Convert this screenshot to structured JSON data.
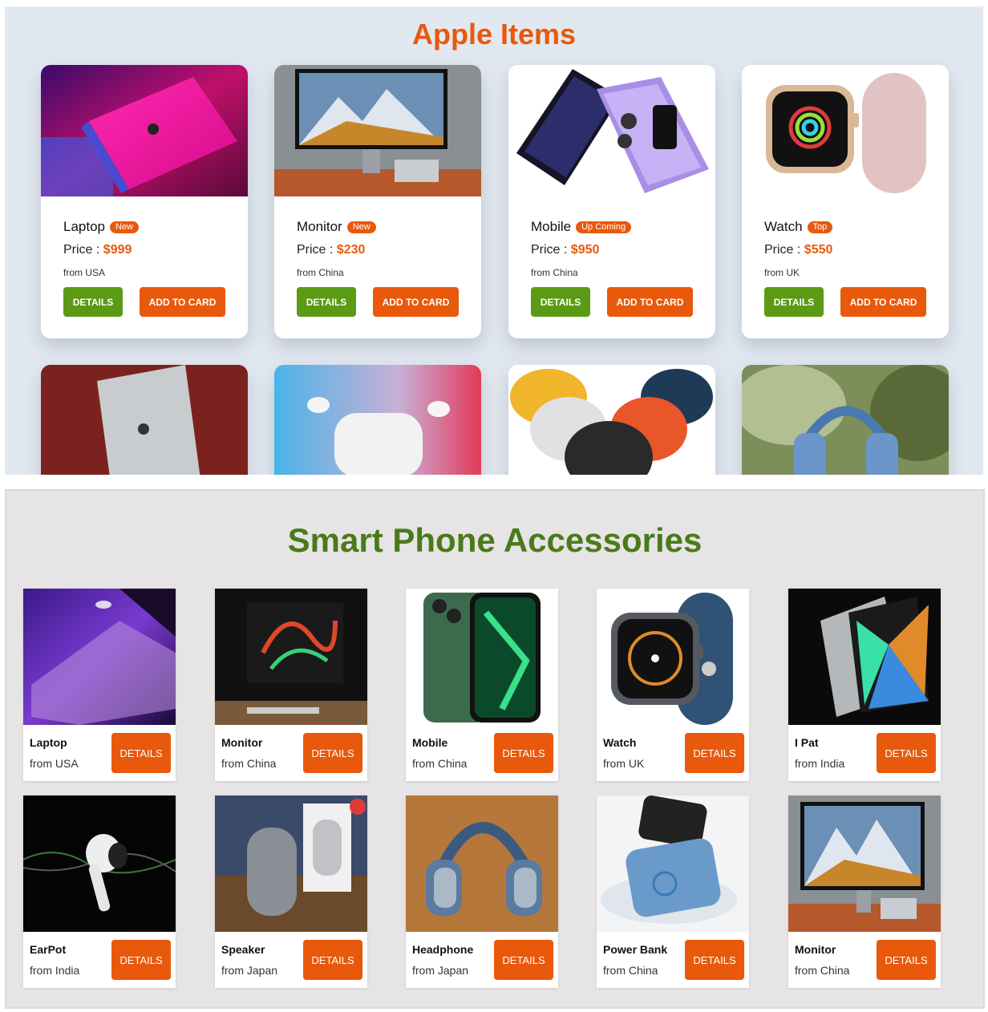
{
  "apple_section": {
    "title": "Apple Items",
    "cards": [
      {
        "name": "Laptop",
        "badge": "New",
        "price_label": "Price : ",
        "price": "$999",
        "from": "from USA",
        "details_label": "DETAILS",
        "add_label": "ADD TO CARD",
        "image": "pink-macbook-image"
      },
      {
        "name": "Monitor",
        "badge": "New",
        "price_label": "Price : ",
        "price": "$230",
        "from": "from China",
        "details_label": "DETAILS",
        "add_label": "ADD TO CARD",
        "image": "studio-display-image"
      },
      {
        "name": "Mobile",
        "badge": "Up Coming",
        "price_label": "Price : ",
        "price": "$950",
        "from": "from China",
        "details_label": "DETAILS",
        "add_label": "ADD TO CARD",
        "image": "iphone-pair-image"
      },
      {
        "name": "Watch",
        "badge": "Top",
        "price_label": "Price : ",
        "price": "$550",
        "from": "from UK",
        "details_label": "DETAILS",
        "add_label": "ADD TO CARD",
        "image": "pink-watch-image"
      }
    ],
    "partial_cards": [
      {
        "image": "ipad-image"
      },
      {
        "image": "airpods-image"
      },
      {
        "image": "homepod-mini-image"
      },
      {
        "image": "airpods-max-image"
      }
    ]
  },
  "accessories_section": {
    "title": "Smart Phone Accessories",
    "cards": [
      {
        "name": "Laptop",
        "from": "from USA",
        "button": "DETAILS",
        "image": "laptop-image"
      },
      {
        "name": "Monitor",
        "from": "from China",
        "button": "DETAILS",
        "image": "monitor-image"
      },
      {
        "name": "Mobile",
        "from": "from China",
        "button": "DETAILS",
        "image": "green-iphone-image"
      },
      {
        "name": "Watch",
        "from": "from UK",
        "button": "DETAILS",
        "image": "blue-watch-image"
      },
      {
        "name": "I Pat",
        "from": "from India",
        "button": "DETAILS",
        "image": "ipad-pro-image"
      },
      {
        "name": "EarPot",
        "from": "from India",
        "button": "DETAILS",
        "image": "earpod-image"
      },
      {
        "name": "Speaker",
        "from": "from Japan",
        "button": "DETAILS",
        "image": "homepod-image"
      },
      {
        "name": "Headphone",
        "from": "from Japan",
        "button": "DETAILS",
        "image": "headphone-image"
      },
      {
        "name": "Power Bank",
        "from": "from China",
        "button": "DETAILS",
        "image": "power-bank-image"
      },
      {
        "name": "Monitor",
        "from": "from China",
        "button": "DETAILS",
        "image": "monitor-mountain-image"
      }
    ]
  },
  "colors": {
    "accent_orange": "#e8590c",
    "details_green": "#5b9a14",
    "accessories_title_green": "#4a7a1a",
    "apple_bg": "#e2e8f0",
    "accessories_bg": "#e6e4e4"
  }
}
